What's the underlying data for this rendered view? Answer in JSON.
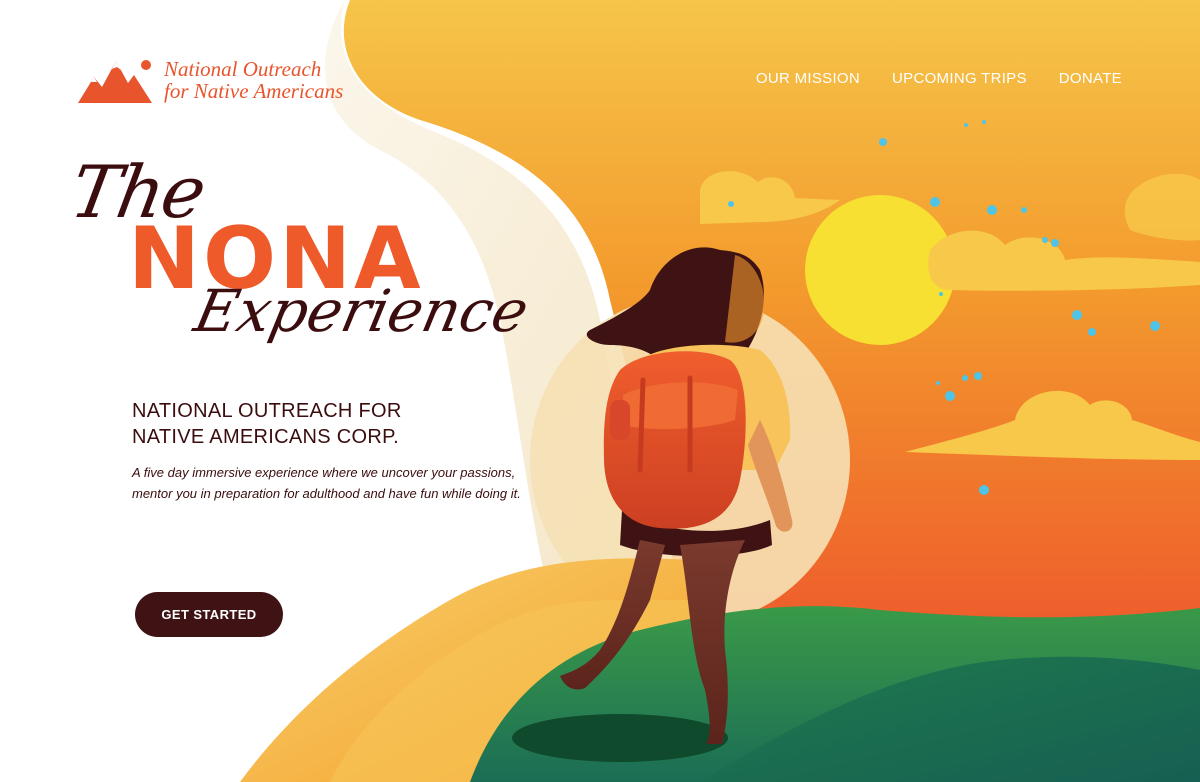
{
  "brand": {
    "name_line1": "National Outreach",
    "name_line2": "for Native Americans",
    "logo_icon": "mountains-sun-icon",
    "color": "#e8552d"
  },
  "nav": {
    "items": [
      {
        "label": "OUR MISSION"
      },
      {
        "label": "UPCOMING TRIPS"
      },
      {
        "label": "DONATE"
      }
    ]
  },
  "hero": {
    "title_the": "The",
    "title_main": "NONA",
    "title_experience": "Experience",
    "subtitle_line1": "NATIONAL OUTREACH FOR",
    "subtitle_line2": "NATIVE AMERICANS CORP.",
    "description": "A five day immersive experience where we uncover your passions, mentor you in preparation for adulthood and have fun while doing it.",
    "cta_label": "GET STARTED"
  },
  "illustration": {
    "subject": "woman-hiker-with-backpack",
    "sun_icon": "sun-icon",
    "colors": {
      "sky_top": "#f6b33a",
      "sky_bottom": "#ef5a2b",
      "sun": "#f7e032",
      "hill": "#1f7a4d",
      "accent_dark": "#3f1314",
      "title_orange": "#ef5a2b"
    }
  }
}
